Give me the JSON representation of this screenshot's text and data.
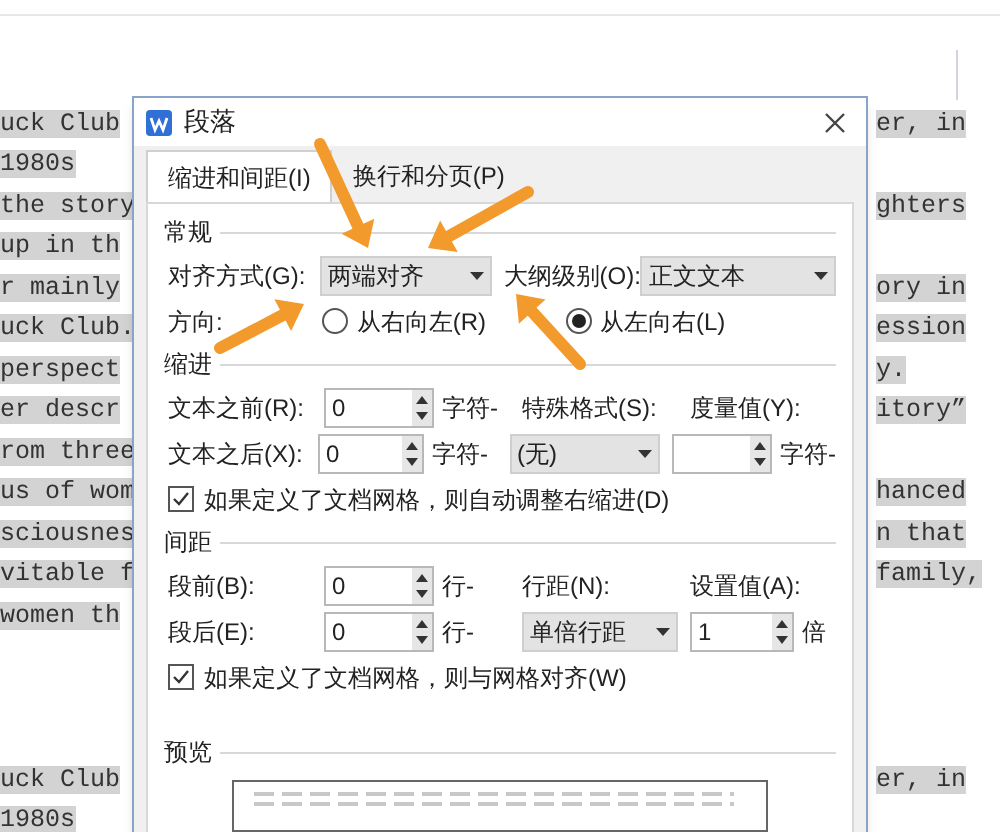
{
  "document": {
    "blocks": [
      {
        "lines": [
          {
            "left": "uck Club",
            "right": "er, in"
          },
          {
            "left": "1980s"
          },
          {
            "left": "the story",
            "right": "ghters"
          },
          {
            "left": "up in th"
          },
          {
            "left": "r mainly",
            "right": "ory in"
          },
          {
            "left": "uck Club.",
            "right": "ession"
          },
          {
            "left": "perspect",
            "right": "y."
          },
          {
            "left": "er descr",
            "right": "itory”"
          },
          {
            "left": "rom three"
          },
          {
            "left": "us of wom",
            "right": "hanced"
          },
          {
            "left": "sciousnes",
            "right": "n that"
          },
          {
            "left": "vitable f",
            "right": "family,"
          },
          {
            "left": "women th"
          }
        ]
      },
      {
        "lines": [
          {
            "left": "uck Club",
            "right": "er, in"
          },
          {
            "left": "1980s"
          }
        ]
      }
    ]
  },
  "dialog": {
    "title": "段落",
    "tabs": [
      {
        "label": "缩进和间距(I)",
        "selected": true
      },
      {
        "label": "换行和分页(P)",
        "selected": false
      }
    ],
    "general": {
      "heading": "常规",
      "alignment_label": "对齐方式(G):",
      "alignment": "两端对齐",
      "outline_label": "大纲级别(O):",
      "outline": "正文文本",
      "direction_label": "方向:",
      "directions": [
        {
          "label": "从右向左(R)",
          "selected": false
        },
        {
          "label": "从左向右(L)",
          "selected": true
        }
      ]
    },
    "indent": {
      "heading": "缩进",
      "before_label": "文本之前(R):",
      "before": "0",
      "before_unit": "字符-",
      "after_label": "文本之后(X):",
      "after": "0",
      "after_unit": "字符-",
      "special_label": "特殊格式(S):",
      "special": "(无)",
      "measure_label": "度量值(Y):",
      "measure_unit": "字符-",
      "auto_adjust": {
        "label": "如果定义了文档网格，则自动调整右缩进(D)",
        "checked": true
      }
    },
    "spacing": {
      "heading": "间距",
      "before_label": "段前(B):",
      "before": "0",
      "before_unit": "行-",
      "after_label": "段后(E):",
      "after": "0",
      "after_unit": "行-",
      "line_label": "行距(N):",
      "line": "单倍行距",
      "value_label": "设置值(A):",
      "value": "1",
      "value_unit": "倍",
      "snap_grid": {
        "label": "如果定义了文档网格，则与网格对齐(W)",
        "checked": true
      }
    },
    "preview": {
      "heading": "预览"
    }
  }
}
